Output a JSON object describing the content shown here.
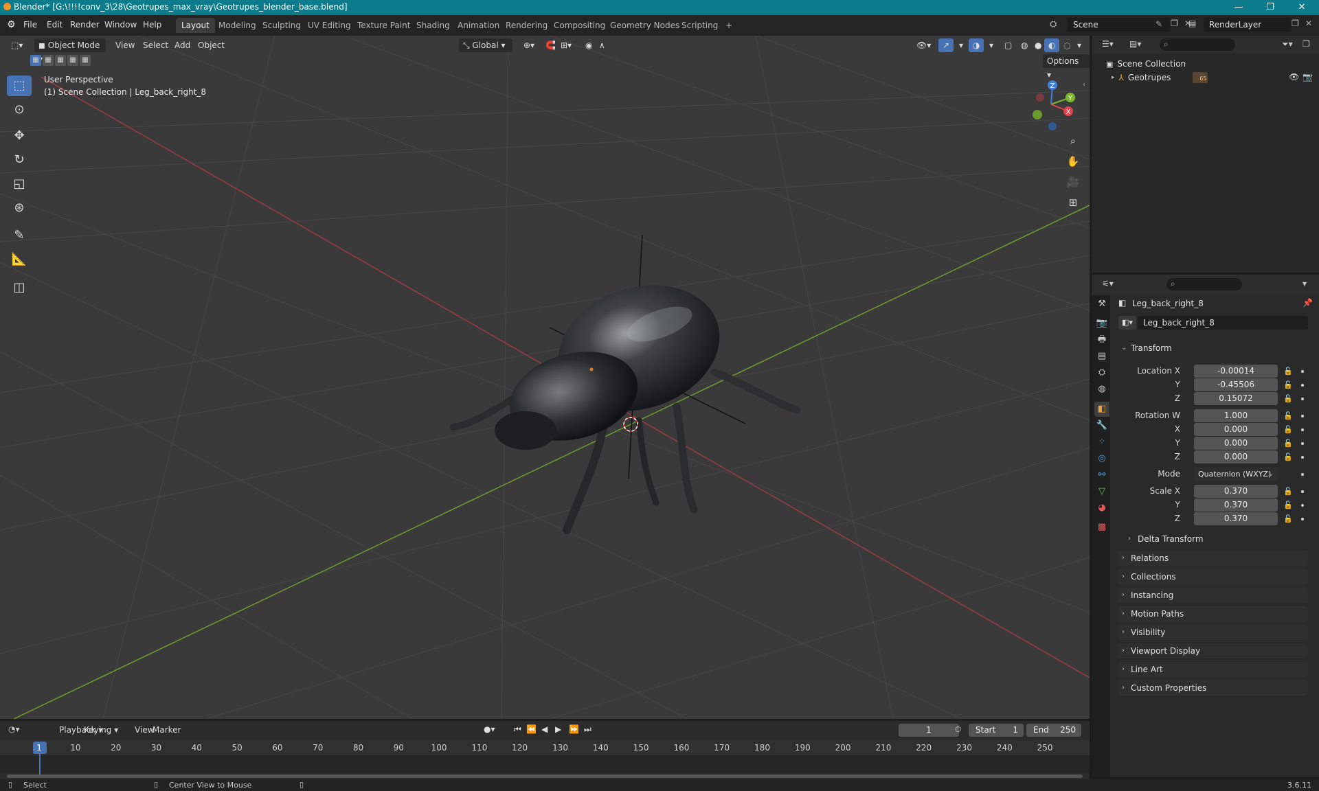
{
  "titlebar": {
    "title": "Blender* [G:\\!!!!conv_3\\28\\Geotrupes_max_vray\\Geotrupes_blender_base.blend]",
    "minimize": "—",
    "maximize": "❐",
    "close": "✕"
  },
  "menu": {
    "items": [
      "File",
      "Edit",
      "Render",
      "Window",
      "Help"
    ],
    "workspaces": [
      "Layout",
      "Modeling",
      "Sculpting",
      "UV Editing",
      "Texture Paint",
      "Shading",
      "Animation",
      "Rendering",
      "Compositing",
      "Geometry Nodes",
      "Scripting"
    ],
    "add_tab": "+",
    "scene_name": "Scene",
    "view_layer": "RenderLayer"
  },
  "viewport": {
    "mode": "Object Mode",
    "menus": [
      "View",
      "Select",
      "Add",
      "Object"
    ],
    "transform_orientation": "Global",
    "options_label": "Options",
    "overlay_title": "User Perspective",
    "overlay_subtitle": "(1) Scene Collection | Leg_back_right_8",
    "gizmo": {
      "z": "Z",
      "y": "Y",
      "x": "X"
    }
  },
  "outliner": {
    "root": "Scene Collection",
    "items": [
      {
        "name": "Geotrupes",
        "badge": "65"
      }
    ]
  },
  "properties": {
    "object_name": "Leg_back_right_8",
    "data_name": "Leg_back_right_8",
    "transform_label": "Transform",
    "location_labels": [
      "Location X",
      "Y",
      "Z"
    ],
    "location": [
      "-0.00014",
      "-0.45506",
      "0.15072"
    ],
    "rotation_labels": [
      "Rotation W",
      "X",
      "Y",
      "Z"
    ],
    "rotation": [
      "1.000",
      "0.000",
      "0.000",
      "0.000"
    ],
    "mode_label": "Mode",
    "mode_value": "Quaternion (WXYZ)",
    "scale_labels": [
      "Scale X",
      "Y",
      "Z"
    ],
    "scale": [
      "0.370",
      "0.370",
      "0.370"
    ],
    "delta_transform": "Delta Transform",
    "panels": [
      "Relations",
      "Collections",
      "Instancing",
      "Motion Paths",
      "Visibility",
      "Viewport Display",
      "Line Art",
      "Custom Properties"
    ]
  },
  "timeline": {
    "menus": [
      "Playback",
      "Keying",
      "View",
      "Marker"
    ],
    "current_frame": "1",
    "start_label": "Start",
    "start": "1",
    "end_label": "End",
    "end": "250",
    "ticks": [
      "1",
      "10",
      "20",
      "30",
      "40",
      "50",
      "60",
      "70",
      "80",
      "90",
      "100",
      "110",
      "120",
      "130",
      "140",
      "150",
      "160",
      "170",
      "180",
      "190",
      "200",
      "210",
      "220",
      "230",
      "240",
      "250"
    ]
  },
  "statusbar": {
    "select": "Select",
    "center": "Center View to Mouse",
    "version": "3.6.11"
  }
}
